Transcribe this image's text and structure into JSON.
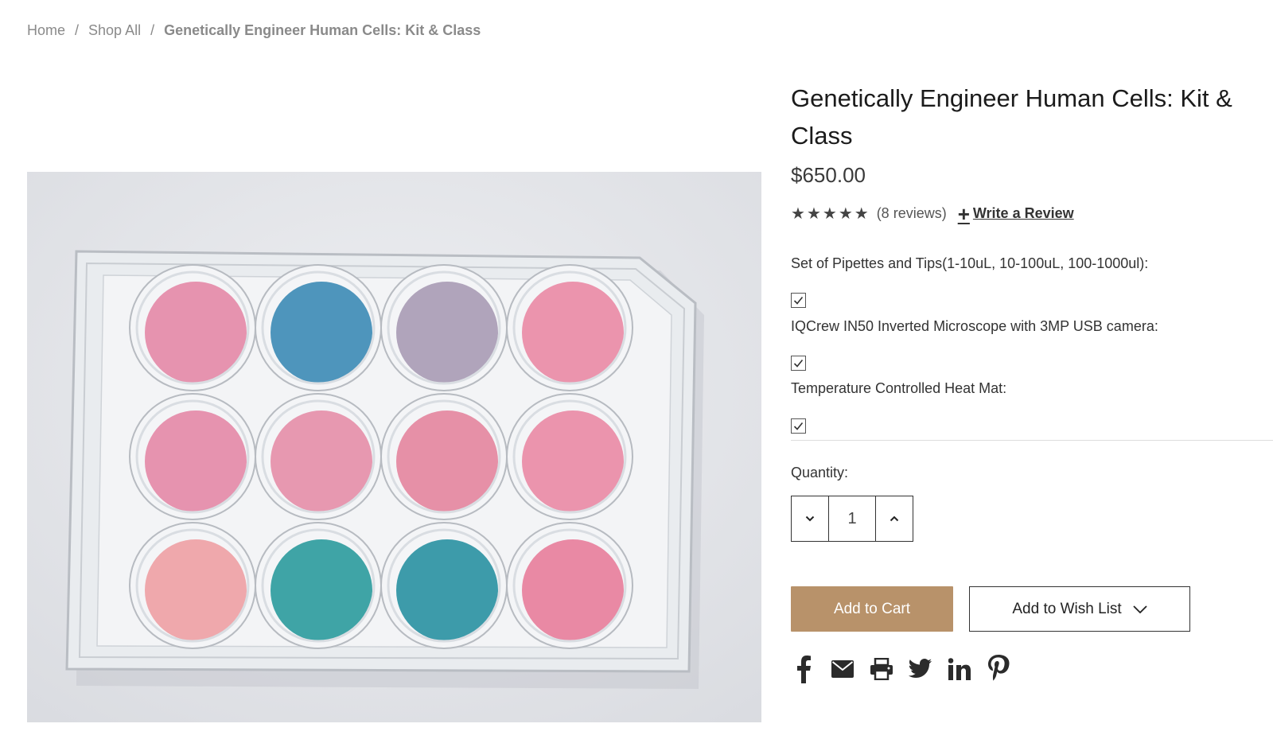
{
  "breadcrumb": {
    "home": "Home",
    "shop_all": "Shop All",
    "current": "Genetically Engineer Human Cells: Kit & Class",
    "separator": "/"
  },
  "product": {
    "title": "Genetically Engineer Human Cells: Kit & Class",
    "price": "$650.00",
    "rating_stars": 5,
    "reviews": "(8 reviews)",
    "write_review": "Write a Review"
  },
  "options": [
    {
      "label": "Set of Pipettes and Tips(1-10uL, 10-100uL, 100-1000ul):",
      "checked": true
    },
    {
      "label": "IQCrew IN50 Inverted Microscope with 3MP USB camera:",
      "checked": true
    },
    {
      "label": "Temperature Controlled Heat Mat:",
      "checked": true
    }
  ],
  "quantity": {
    "label": "Quantity:",
    "value": "1"
  },
  "actions": {
    "add_to_cart": "Add to Cart",
    "add_to_wishlist": "Add to Wish List"
  },
  "social": [
    "facebook-icon",
    "email-icon",
    "print-icon",
    "twitter-icon",
    "linkedin-icon",
    "pinterest-icon"
  ],
  "colors": {
    "accent": "#b8926a",
    "text": "#1b1b1b",
    "muted": "#8a8a8a"
  }
}
